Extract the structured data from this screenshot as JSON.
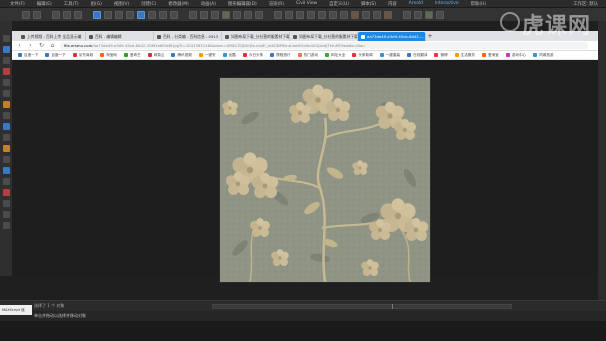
{
  "app_menu": {
    "items": [
      "文件(F)",
      "编辑(E)",
      "工具(T)",
      "组(G)",
      "视图(V)",
      "创建(C)",
      "修改器(M)",
      "动画(A)",
      "图形编辑器(D)",
      "渲染(R)",
      "Civil View",
      "自定义(U)",
      "脚本(S)",
      "内容",
      "Arnold",
      "Interactive",
      "帮助(H)"
    ],
    "layout_label": "工作区: 默认"
  },
  "browser": {
    "tabs": [
      {
        "label": "上传视频 - 百科上传 全品显示编"
      },
      {
        "label": "百科 - 编辑编辑"
      },
      {
        "label": "百科 - 分类编 - 百科信息 - 0913"
      },
      {
        "label": "如图布局下载_分社营的服素材下载"
      },
      {
        "label": "如图布局下载_分社营的服素材下载"
      },
      {
        "label": "aa73da49-e3d9-45cb-8d42-..."
      }
    ],
    "active_tab_index": 5,
    "new_tab_glyph": "+",
    "url_host": "file.ersmu.com",
    "url_path": "/aa73da49-e3d9-45cb-8d42-308f1e6f1b8f.jpg?t=1541395146&token=ZMkCZQKXQfe-msfE_sktZ4MRknd-bw9Oa9o4VGjkxdjTkfuMY9ew8a-d4au",
    "bookmarks": [
      {
        "label": "百度一下",
        "color": "#3b78c4"
      },
      {
        "label": "百度一下",
        "color": "#3b78c4"
      },
      {
        "label": "京东商城",
        "color": "#d33"
      },
      {
        "label": "淘宝网",
        "color": "#f60"
      },
      {
        "label": "爱奇艺",
        "color": "#2a2"
      },
      {
        "label": "网易云",
        "color": "#c33"
      },
      {
        "label": "腾讯视频",
        "color": "#3b78c4"
      },
      {
        "label": "一键安",
        "color": "#f90"
      },
      {
        "label": "优酷",
        "color": "#39c"
      },
      {
        "label": "今日头条",
        "color": "#d33"
      },
      {
        "label": "携程旅行",
        "color": "#3b78c4"
      },
      {
        "label": "热门游戏",
        "color": "#e74"
      },
      {
        "label": "网址大全",
        "color": "#3a3"
      },
      {
        "label": "头条新闻",
        "color": "#d33"
      },
      {
        "label": "一键重装",
        "color": "#39c"
      },
      {
        "label": "在线翻译",
        "color": "#3b78c4"
      },
      {
        "label": "微博",
        "color": "#e33"
      },
      {
        "label": "生活服务",
        "color": "#f90"
      },
      {
        "label": "爱淘宝",
        "color": "#f60"
      },
      {
        "label": "游戏中心",
        "color": "#c3c"
      },
      {
        "label": "同城旅游",
        "color": "#39c"
      }
    ]
  },
  "status": {
    "selection": "选择了 1 个 对象",
    "prompt": "单击并拖动以选择并移动对象",
    "maxscript": "MAXScript 迷"
  },
  "watermark": "虎课网",
  "colors": {
    "active_tab": "#1e88e5",
    "texture_base": "#8e9383",
    "flower": "#c8b994",
    "leaf": "#707869"
  }
}
